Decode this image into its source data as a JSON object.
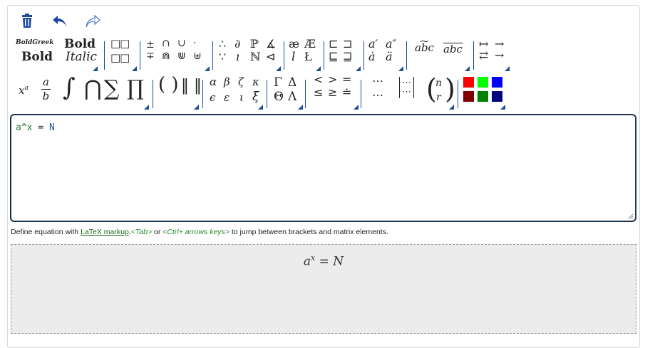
{
  "actions": {
    "delete": "trash-icon",
    "undo": "undo-icon",
    "redo": "redo-icon"
  },
  "toolbar": {
    "fonts": {
      "line1": "BoldGreek",
      "line2": "Bold",
      "bold": "Bold",
      "italic": "Italic"
    },
    "ops": {
      "pm": "±",
      "mp": "∓",
      "cap": "∩",
      "cup": "∪",
      "dot": "·",
      "Cap": "⋒",
      "Cup": "⋓",
      "uplus": "⊎"
    },
    "logic": {
      "therefore": "∴",
      "because": "∵",
      "partial": "∂",
      "imath": "ı",
      "P": "ℙ",
      "N": "ℕ",
      "angle": "∡",
      "tri": "⊲"
    },
    "letters": {
      "ae": "æ",
      "AE": "Æ",
      "l": "l",
      "L": "Ł"
    },
    "sets": {
      "a1": "⊏",
      "a2": "⊐",
      "b1": "⊑",
      "b2": "⊒"
    },
    "accents": {
      "prime": "a′",
      "dprime": "a″",
      "dot": "ȧ",
      "ddot": "ä"
    },
    "wide": {
      "tilde": "abc",
      "line": "abc"
    },
    "arrows": {
      "mapsto": "↦",
      "to": "→",
      "lr": "⇄",
      "to2": "→"
    },
    "big": {
      "int": "∫",
      "bigcap": "⋂",
      "sum": "∑",
      "prod": "∏"
    },
    "delims": {
      "paren": "( )",
      "bars": "‖ ‖"
    },
    "greek": {
      "alpha": "α",
      "beta": "β",
      "zeta": "ζ",
      "kappa": "κ",
      "epsilon": "ϵ",
      "varepsilon": "ε",
      "iota": "ι",
      "xi": "ξ"
    },
    "greekU": {
      "Gamma": "Γ",
      "Delta": "Δ",
      "Theta": "Θ",
      "Lambda": "Λ"
    },
    "rel": {
      "lt": "<",
      "gt": ">",
      "eq": "=",
      "le": "≤",
      "ge": "≥",
      "doteq": "≐"
    },
    "dots": {
      "c": "⋯",
      "c2": "⋯"
    },
    "binom": {
      "n": "n",
      "r": "r"
    },
    "colors": [
      "#ff0000",
      "#00ff00",
      "#0000ff",
      "#800000",
      "#008000",
      "#000080"
    ]
  },
  "editor": {
    "code_a": "a",
    "code_op": "^",
    "code_x": "x",
    "code_eq": " = ",
    "code_N": "N"
  },
  "help": {
    "prefix": "Define equation with ",
    "link": "LaTeX markup",
    "dot": ".",
    "tab": "<Tab>",
    "or": " or ",
    "keys": "<Ctrl+ arrows keys>",
    "suffix": " to jump between brackets and matrix elements."
  },
  "preview": {
    "base": "a",
    "sup": "x",
    "rest": " = N"
  }
}
